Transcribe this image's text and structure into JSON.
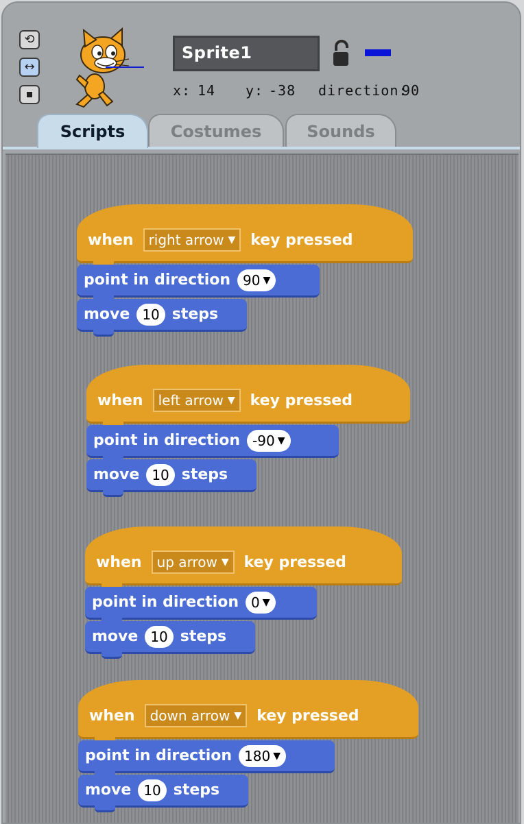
{
  "sprite": {
    "name": "Sprite1",
    "x_label": "x:",
    "x": "14",
    "y_label": "y:",
    "y": "-38",
    "direction_label": "direction:",
    "direction": "90"
  },
  "rotation_styles": [
    {
      "icon": "rotate-icon"
    },
    {
      "icon": "left-right-icon"
    },
    {
      "icon": "no-rotate-icon"
    }
  ],
  "tabs": [
    {
      "label": "Scripts",
      "active": true
    },
    {
      "label": "Costumes",
      "active": false
    },
    {
      "label": "Sounds",
      "active": false
    }
  ],
  "scripts": [
    {
      "when": "when",
      "key": "right arrow",
      "pressed": "key pressed",
      "point": "point in direction",
      "direction": "90",
      "move": "move",
      "steps_value": "10",
      "steps": "steps"
    },
    {
      "when": "when",
      "key": "left arrow",
      "pressed": "key pressed",
      "point": "point in direction",
      "direction": "-90",
      "move": "move",
      "steps_value": "10",
      "steps": "steps"
    },
    {
      "when": "when",
      "key": "up arrow",
      "pressed": "key pressed",
      "point": "point in direction",
      "direction": "0",
      "move": "move",
      "steps_value": "10",
      "steps": "steps"
    },
    {
      "when": "when",
      "key": "down arrow",
      "pressed": "key pressed",
      "point": "point in direction",
      "direction": "180",
      "move": "move",
      "steps_value": "10",
      "steps": "steps"
    }
  ],
  "colors": {
    "events": "#e3a024",
    "motion": "#4a6cd4",
    "direction_indicator": "#0a14d8"
  }
}
